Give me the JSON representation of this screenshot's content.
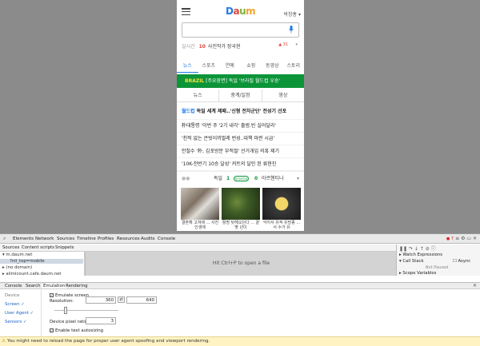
{
  "mobile": {
    "logo": [
      "D",
      "a",
      "u",
      "m"
    ],
    "user": "박창홍 ▾",
    "search_placeholder": "",
    "realtime": {
      "label": "실시간",
      "rank": "10",
      "text": "사진작가 장국현",
      "change": "▲ 31"
    },
    "tabs": [
      "뉴스",
      "스포츠",
      "연예",
      "쇼핑",
      "동영상",
      "스토리"
    ],
    "banner": {
      "prefix": "BRAZIL",
      "text": "[주요장면] 독일 '브라질 월드컵 우승'"
    },
    "subtabs": [
      "뉴스",
      "중계/일정",
      "영상"
    ],
    "news": [
      {
        "hl": "월드컵",
        "text": "독일 세계 제패..'신형 전차군단' 전성기 선포"
      },
      {
        "hl": "",
        "text": "朴대통령 '이번 주 '2기 내각' 출범.빈 실어달라'"
      },
      {
        "hl": "",
        "text": "'천적 없는 큰빗이끼벌레 번성..대책 마련 시급'"
      },
      {
        "hl": "",
        "text": "안철수 '朴, 김포방문 부적절' 선거개입 의혹 제기"
      },
      {
        "hl": "",
        "text": "'10K-전반기 10승 달성' 커트의 달인 된 류현진"
      }
    ],
    "score": {
      "team1": "독일",
      "score1": "1",
      "badge": "하이라이트",
      "score2": "0",
      "team2": "아르헨티나"
    },
    "thumbs": [
      {
        "cap": "결혼해 고쳐에 ... 사진 인생에"
      },
      {
        "cap": "활명 탓해오던다 ... 끝 몇 년이"
      },
      {
        "cap": "악지서 유적 유망종 ... 서 수거 유"
      }
    ]
  },
  "devtools": {
    "tabs": [
      "Elements",
      "Network",
      "Sources",
      "Timeline",
      "Profiles",
      "Resources",
      "Audits",
      "Console"
    ],
    "errors": "● 7",
    "source_tabs": [
      "Sources",
      "Content scripts",
      "Snippets"
    ],
    "tree": [
      "▾ m.daum.net",
      "?nil_top=mobile",
      "▸ (no domain)",
      "▸ alimicount.cafe.daum.net"
    ],
    "editor_hint": "Hit Ctrl+P to open a file",
    "debugger": {
      "watch": "▸ Watch Expressions",
      "callstack": "▾ Call Stack",
      "async": "Async",
      "not_paused": "Not Paused",
      "scope": "▸ Scope Variables"
    },
    "drawer_tabs": [
      "Console",
      "Search",
      "Emulation",
      "Rendering"
    ],
    "emulation": {
      "nav": [
        "Device",
        "Screen ✓",
        "User Agent ✓",
        "Sensors ✓"
      ],
      "emulate_screen": "Emulate screen",
      "resolution_label": "Resolution:",
      "width": "360",
      "height": "640",
      "swap": "⇄",
      "dpr_label": "Device pixel ratio:",
      "dpr": "3",
      "text_autosizing": "Enable text autosizing",
      "check": "✓"
    },
    "status": "You might need to reload the page for proper user agent spoofing and viewport rendering."
  }
}
